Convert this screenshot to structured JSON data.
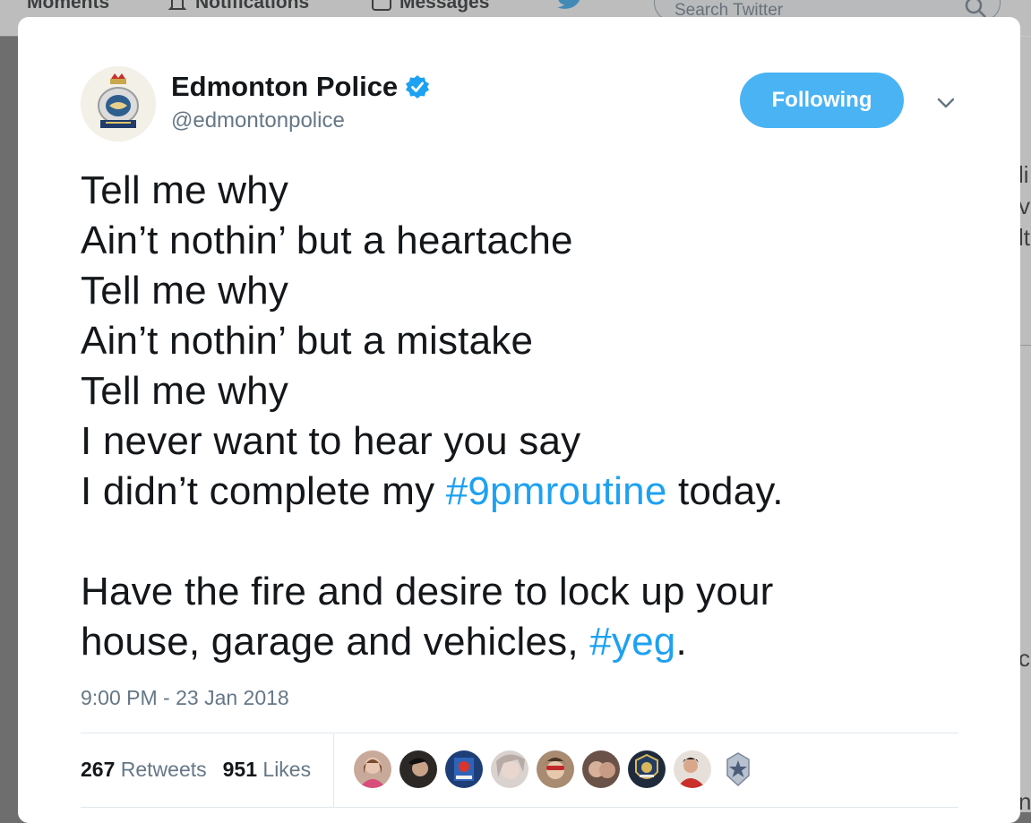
{
  "nav": {
    "moments": "Moments",
    "notifications": "Notifications",
    "messages": "Messages",
    "search_placeholder": "Search Twitter"
  },
  "tweet": {
    "display_name": "Edmonton Police",
    "handle": "@edmontonpolice",
    "follow_label": "Following",
    "lines": [
      "Tell me why",
      "Ain’t nothin’ but a heartache",
      "Tell me why",
      "Ain’t nothin’ but a mistake",
      "Tell me why",
      "I never want to hear you say"
    ],
    "line7_pre": "I didn’t complete my ",
    "hashtag1": "#9pmroutine",
    "line7_post": " today.",
    "para2_pre": "Have the fire and desire to lock up your\nhouse, garage and vehicles, ",
    "hashtag2": "#yeg",
    "para2_post": ".",
    "timestamp": "9:00 PM - 23 Jan 2018"
  },
  "stats": {
    "retweets_count": "267",
    "retweets_label": "Retweets",
    "likes_count": "951",
    "likes_label": "Likes"
  },
  "liker_avatars": [
    {
      "name": "liker-avatar-1",
      "color": "#b98e7e"
    },
    {
      "name": "liker-avatar-2",
      "color": "#3a3330"
    },
    {
      "name": "liker-avatar-3",
      "color": "#2a4e8a"
    },
    {
      "name": "liker-avatar-4",
      "color": "#d5c9c4"
    },
    {
      "name": "liker-avatar-5",
      "color": "#c4a78f"
    },
    {
      "name": "liker-avatar-6",
      "color": "#8a6a5c"
    },
    {
      "name": "liker-avatar-7",
      "color": "#2c3b52"
    },
    {
      "name": "liker-avatar-8",
      "color": "#b23a34"
    },
    {
      "name": "liker-avatar-9",
      "color": "#9eaabc"
    }
  ],
  "colors": {
    "accent": "#1da1f2",
    "follow_button": "#4ab3f4",
    "text": "#14171a",
    "muted": "#657786",
    "verified": "#1da1f2"
  }
}
